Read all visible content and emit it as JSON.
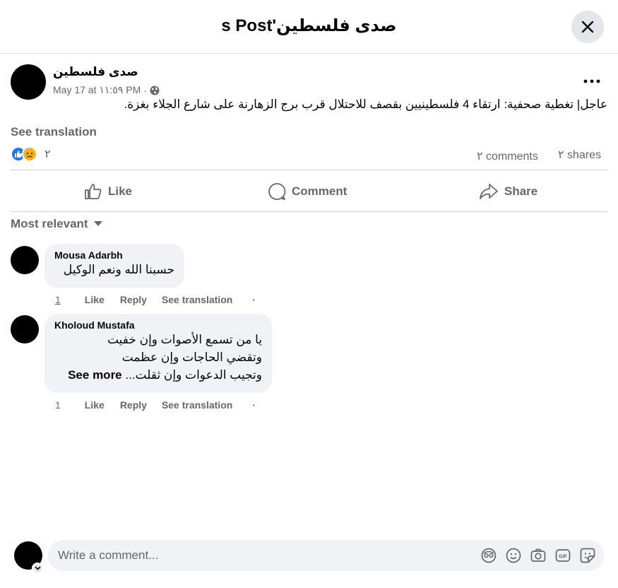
{
  "header": {
    "title": "s Post'صدى فلسطين"
  },
  "post": {
    "page_name": "صدى فلسطين",
    "timestamp": "May 17 at ١١:٥٩ PM",
    "separator": "·",
    "text": "عاجل| تغطية صحفية: ارتقاء 4 فلسطينيين بقصف للاحتلال قرب برج الزهارنة على شارع الجلاء بغزة.",
    "see_translation": "See translation",
    "reactions_count": "٢",
    "comments_count": "٢ comments",
    "shares_count": "٢ shares"
  },
  "actions": {
    "like": "Like",
    "comment": "Comment",
    "share": "Share"
  },
  "sort": {
    "label": "Most relevant"
  },
  "comments": [
    {
      "author": "Mousa Adarbh",
      "text": "حسبنا الله ونعم الوكيل",
      "time": "1",
      "like": "Like",
      "reply": "Reply",
      "translate": "See translation",
      "dot": "·"
    },
    {
      "author": "Kholoud Mustafa",
      "lines": [
        "يا من تسمع الأصوات وإن خفيت",
        "وتقضي الحاجات وإن عظمت",
        "وتجيب الدعوات وإن ثقلت..."
      ],
      "see_more": "See more",
      "time": "1",
      "like": "Like",
      "reply": "Reply",
      "translate": "See translation",
      "dot": "·"
    }
  ],
  "composer": {
    "placeholder": "Write a comment..."
  },
  "colors": {
    "like_blue": "#1877f2",
    "sad_yellow": "#f7b125",
    "muted": "#65676b",
    "bubble": "#f0f2f5"
  },
  "icons": [
    "close-icon",
    "more-icon",
    "globe-icon",
    "like-reaction-icon",
    "sad-reaction-icon",
    "thumbs-up-icon",
    "comment-icon",
    "share-icon",
    "caret-down-icon",
    "avatar-icon",
    "camera-icon",
    "emoji-icon",
    "gif-icon",
    "sticker-icon"
  ]
}
